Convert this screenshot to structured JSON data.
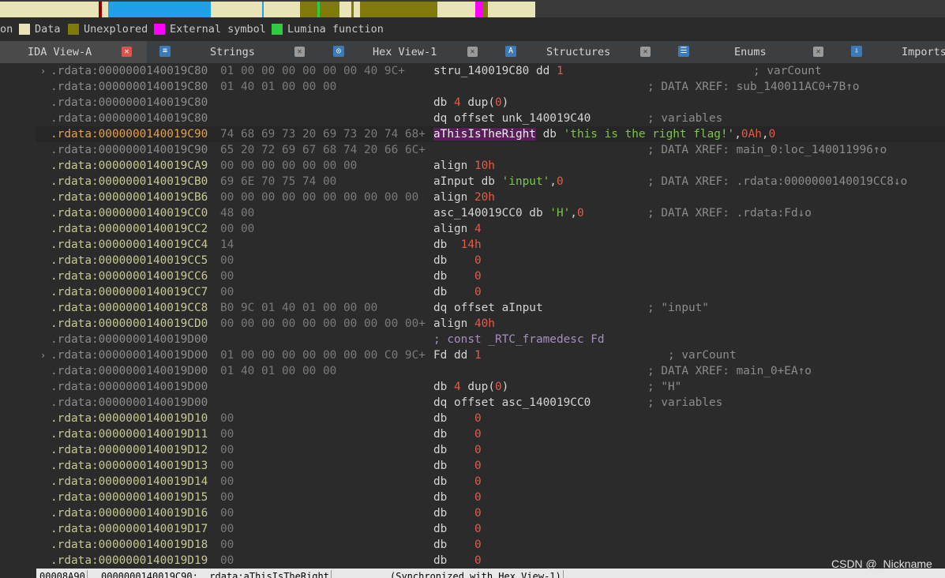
{
  "legend": {
    "first_fragment": "on",
    "items": [
      {
        "label": "Data",
        "color": "#e8e4b8"
      },
      {
        "label": "Unexplored",
        "color": "#7f7a0a"
      },
      {
        "label": "External symbol",
        "color": "#ff00ff"
      },
      {
        "label": "Lumina function",
        "color": "#2ecc40"
      }
    ]
  },
  "tabs": [
    {
      "label": "IDA View-A",
      "active": true,
      "icon": "ida-view-icon"
    },
    {
      "label": "Strings",
      "active": false,
      "icon": "strings-icon"
    },
    {
      "label": "Hex View-1",
      "active": false,
      "icon": "hex-view-icon"
    },
    {
      "label": "Structures",
      "active": false,
      "icon": "structures-icon"
    },
    {
      "label": "Enums",
      "active": false,
      "icon": "enums-icon"
    },
    {
      "label": "Imports",
      "active": false,
      "icon": "imports-icon"
    }
  ],
  "close_glyph": "✕",
  "lines": [
    {
      "addr": ".rdata:0000000140019C80",
      "bytes": "01 00 00 00 00 00 00 40 9C+",
      "instr": "stru_140019C80 dd 1",
      "comment": "; varCount",
      "chevron": "›",
      "dot": false
    },
    {
      "addr": ".rdata:0000000140019C80",
      "bytes": "01 40 01 00 00 00",
      "instr": "",
      "comment": "; DATA XREF: sub_140011AC0+7B↑o",
      "dot": false
    },
    {
      "addr": ".rdata:0000000140019C80",
      "bytes": "",
      "instr": "db 4 dup(0)",
      "comment": "",
      "dot": false
    },
    {
      "addr": ".rdata:0000000140019C80",
      "bytes": "",
      "instr": "dq offset unk_140019C40",
      "comment": "; variables",
      "dot": false
    },
    {
      "addr": ".rdata:0000000140019C90",
      "bytes": "74 68 69 73 20 69 73 20 74 68+",
      "instr": "aThisIsTheRight db 'this is the right flag!',0Ah,0",
      "comment": "",
      "dot": true,
      "highlight": true
    },
    {
      "addr": ".rdata:0000000140019C90",
      "bytes": "65 20 72 69 67 68 74 20 66 6C+",
      "instr": "",
      "comment": "; DATA XREF: main_0:loc_140011996↑o",
      "dot": false
    },
    {
      "addr": ".rdata:0000000140019CA9",
      "bytes": "00 00 00 00 00 00 00",
      "instr": "align 10h",
      "comment": "",
      "dot": true
    },
    {
      "addr": ".rdata:0000000140019CB0",
      "bytes": "69 6E 70 75 74 00",
      "instr": "aInput db 'input',0",
      "comment": "; DATA XREF: .rdata:0000000140019CC8↓o",
      "dot": true
    },
    {
      "addr": ".rdata:0000000140019CB6",
      "bytes": "00 00 00 00 00 00 00 00 00 00",
      "instr": "align 20h",
      "comment": "",
      "dot": true
    },
    {
      "addr": ".rdata:0000000140019CC0",
      "bytes": "48 00",
      "instr": "asc_140019CC0 db 'H',0",
      "comment": "; DATA XREF: .rdata:Fd↓o",
      "dot": true
    },
    {
      "addr": ".rdata:0000000140019CC2",
      "bytes": "00 00",
      "instr": "align 4",
      "comment": "",
      "dot": true
    },
    {
      "addr": ".rdata:0000000140019CC4",
      "bytes": "14",
      "instr": "db  14h",
      "comment": "",
      "dot": true
    },
    {
      "addr": ".rdata:0000000140019CC5",
      "bytes": "00",
      "instr": "db    0",
      "comment": "",
      "dot": true
    },
    {
      "addr": ".rdata:0000000140019CC6",
      "bytes": "00",
      "instr": "db    0",
      "comment": "",
      "dot": true
    },
    {
      "addr": ".rdata:0000000140019CC7",
      "bytes": "00",
      "instr": "db    0",
      "comment": "",
      "dot": true
    },
    {
      "addr": ".rdata:0000000140019CC8",
      "bytes": "B0 9C 01 40 01 00 00 00",
      "instr": "dq offset aInput",
      "comment": "; \"input\"",
      "dot": true
    },
    {
      "addr": ".rdata:0000000140019CD0",
      "bytes": "00 00 00 00 00 00 00 00 00 00+",
      "instr": "align 40h",
      "comment": "",
      "dot": true
    },
    {
      "addr": ".rdata:0000000140019D00",
      "bytes": "",
      "instr": "; const _RTC_framedesc Fd",
      "comment": "",
      "dot": false
    },
    {
      "addr": ".rdata:0000000140019D00",
      "bytes": "01 00 00 00 00 00 00 00 C0 9C+",
      "instr": "Fd dd 1",
      "comment": "; varCount",
      "chevron": "›",
      "dot": false
    },
    {
      "addr": ".rdata:0000000140019D00",
      "bytes": "01 40 01 00 00 00",
      "instr": "",
      "comment": "; DATA XREF: main_0+EA↑o",
      "dot": false
    },
    {
      "addr": ".rdata:0000000140019D00",
      "bytes": "",
      "instr": "db 4 dup(0)",
      "comment": "; \"H\"",
      "dot": false
    },
    {
      "addr": ".rdata:0000000140019D00",
      "bytes": "",
      "instr": "dq offset asc_140019CC0",
      "comment": "; variables",
      "dot": false
    },
    {
      "addr": ".rdata:0000000140019D10",
      "bytes": "00",
      "instr": "db    0",
      "comment": "",
      "dot": true
    },
    {
      "addr": ".rdata:0000000140019D11",
      "bytes": "00",
      "instr": "db    0",
      "comment": "",
      "dot": true
    },
    {
      "addr": ".rdata:0000000140019D12",
      "bytes": "00",
      "instr": "db    0",
      "comment": "",
      "dot": true
    },
    {
      "addr": ".rdata:0000000140019D13",
      "bytes": "00",
      "instr": "db    0",
      "comment": "",
      "dot": true
    },
    {
      "addr": ".rdata:0000000140019D14",
      "bytes": "00",
      "instr": "db    0",
      "comment": "",
      "dot": true
    },
    {
      "addr": ".rdata:0000000140019D15",
      "bytes": "00",
      "instr": "db    0",
      "comment": "",
      "dot": true
    },
    {
      "addr": ".rdata:0000000140019D16",
      "bytes": "00",
      "instr": "db    0",
      "comment": "",
      "dot": true
    },
    {
      "addr": ".rdata:0000000140019D17",
      "bytes": "00",
      "instr": "db    0",
      "comment": "",
      "dot": true
    },
    {
      "addr": ".rdata:0000000140019D18",
      "bytes": "00",
      "instr": "db    0",
      "comment": "",
      "dot": true
    },
    {
      "addr": ".rdata:0000000140019D19",
      "bytes": "00",
      "instr": "db    0",
      "comment": "",
      "dot": true
    }
  ],
  "status": {
    "offset": "00008A90",
    "location": "0000000140019C90: .rdata:aThisIsTheRight",
    "sync": "(Synchronized with Hex View-1)"
  },
  "watermark": "CSDN @_Nickname"
}
